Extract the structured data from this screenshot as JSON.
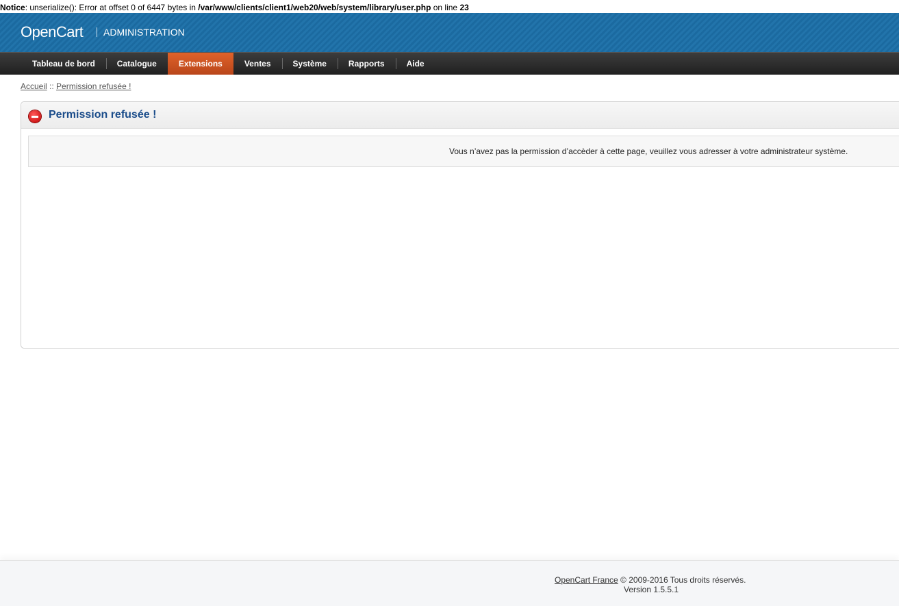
{
  "notice": {
    "label": "Notice",
    "message": ": unserialize(): Error at offset 0 of 6447 bytes in ",
    "path": "/var/www/clients/client1/web20/web/system/library/user.php",
    "line_text": " on line ",
    "line_number": "23"
  },
  "header": {
    "logo": "OpenCart",
    "subtitle": "ADMINISTRATION"
  },
  "menu": {
    "items": [
      {
        "label": "Tableau de bord"
      },
      {
        "label": "Catalogue"
      },
      {
        "label": "Extensions"
      },
      {
        "label": "Ventes"
      },
      {
        "label": "Système"
      },
      {
        "label": "Rapports"
      },
      {
        "label": "Aide"
      }
    ],
    "active_index": 2,
    "active_color": "#cf5422"
  },
  "breadcrumb": {
    "home": "Accueil",
    "separator": " :: ",
    "current": "Permission refusée !"
  },
  "box": {
    "title": "Permission refusée !",
    "icon": "stop-icon",
    "message": "Vous n’avez pas la permission d’accèder à cette page, veuillez vous adresser à votre administrateur système."
  },
  "footer": {
    "link": "OpenCart France",
    "copyright": " © 2009-2016 Tous droits réservés.",
    "version": "Version 1.5.5.1"
  }
}
